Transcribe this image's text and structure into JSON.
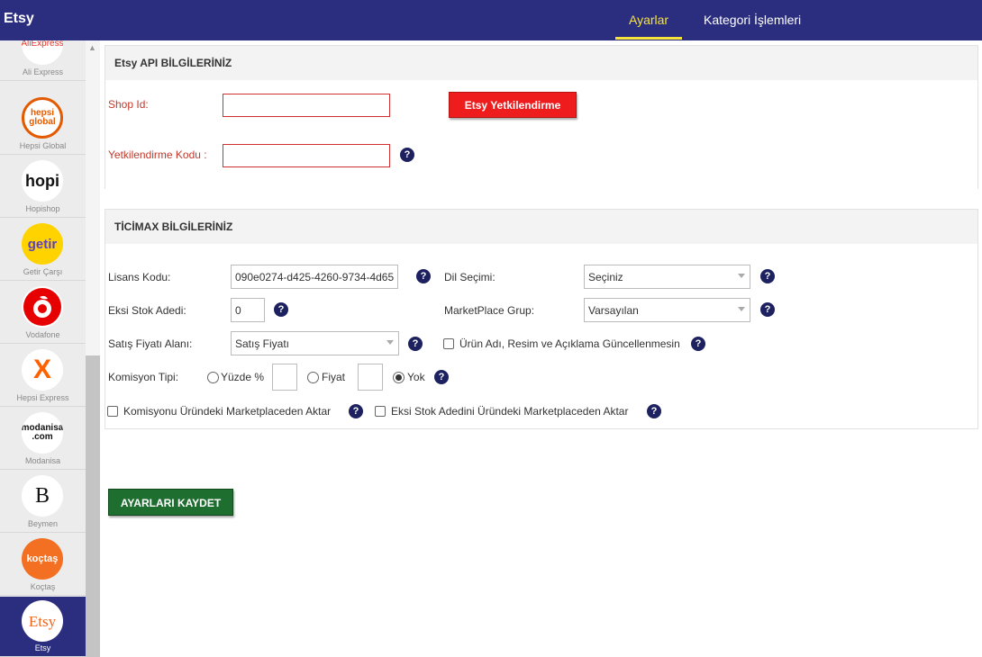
{
  "app": {
    "title": "Etsy"
  },
  "nav": {
    "tabs": [
      {
        "label": "Ayarlar",
        "active": true
      },
      {
        "label": "Kategori İşlemleri",
        "active": false
      }
    ]
  },
  "sidebar": {
    "items": [
      {
        "label": "Ali Express",
        "logo_text": "AliExpress",
        "logo_color": "#e43225"
      },
      {
        "label": "Hepsi Global",
        "logo_text": "hepsi global",
        "logo_color": "#e35a00"
      },
      {
        "label": "Hopishop",
        "logo_text": "hopi",
        "logo_color": "#111111"
      },
      {
        "label": "Getir Çarşı",
        "logo_text": "getir",
        "logo_color": "#5d3ebc"
      },
      {
        "label": "Vodafone",
        "logo_text": "",
        "logo_color": "#e60000"
      },
      {
        "label": "Hepsi Express",
        "logo_text": "X",
        "logo_color": "#ff6000"
      },
      {
        "label": "Modanisa",
        "logo_text": "modanisa .com",
        "logo_color": "#111111"
      },
      {
        "label": "Beymen",
        "logo_text": "B",
        "logo_color": "#111111"
      },
      {
        "label": "Koçtaş",
        "logo_text": "koçtaş",
        "logo_color": "#ffffff"
      },
      {
        "label": "Etsy",
        "logo_text": "Etsy",
        "logo_color": "#f1641e",
        "active": true
      }
    ]
  },
  "etsy_api": {
    "title": "Etsy API BİLGİLERİNİZ",
    "shop_id_label": "Shop Id:",
    "shop_id_value": "",
    "auth_code_label": "Yetkilendirme Kodu :",
    "auth_code_value": "",
    "auth_button": "Etsy Yetkilendirme"
  },
  "ticimax": {
    "title": "TİCİMAX BİLGİLERİNİZ",
    "license_label": "Lisans Kodu:",
    "license_value": "090e0274-d425-4260-9734-4d65",
    "language_label": "Dil Seçimi:",
    "language_value": "Seçiniz",
    "negative_stock_label": "Eksi Stok Adedi:",
    "negative_stock_value": "0",
    "marketplace_group_label": "MarketPlace Grup:",
    "marketplace_group_value": "Varsayılan",
    "sale_price_label": "Satış Fiyatı Alanı:",
    "sale_price_value": "Satış Fiyatı",
    "no_update_label": "Ürün Adı, Resim ve Açıklama Güncellenmesin",
    "commission_type_label": "Komisyon Tipi:",
    "commission_options": [
      "Yüzde %",
      "Fiyat",
      "Yok"
    ],
    "commission_selected": "Yok",
    "transfer_commission_label": "Komisyonu Üründeki Marketplaceden Aktar",
    "transfer_stock_label": "Eksi Stok Adedini Üründeki Marketplaceden Aktar"
  },
  "help_glyph": "?",
  "save_button": "AYARLARI KAYDET",
  "colors": {
    "header_bg": "#2b2e7e",
    "active_tab": "#f6e23a",
    "auth_button": "#ee1c1c",
    "save_button": "#1e6e30",
    "help_icon": "#1d2160"
  }
}
